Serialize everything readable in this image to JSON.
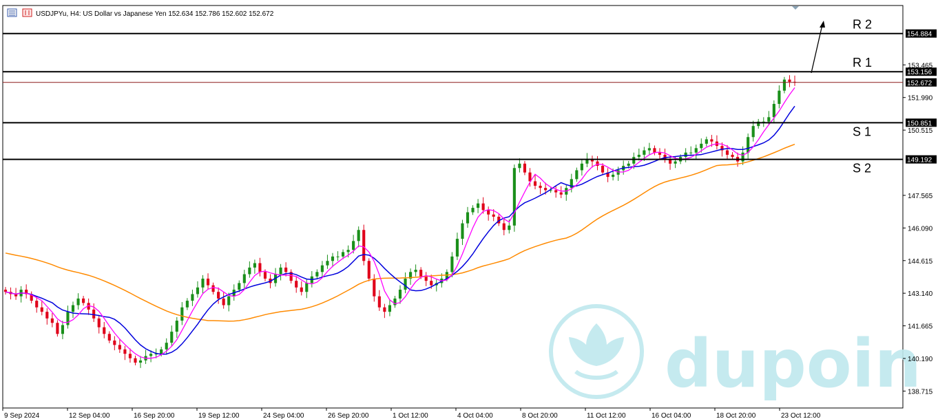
{
  "header": {
    "symbol_text": "USDJPYu, H4:  US Dollar vs Japanese Yen  152.634 152.786 152.602 152.672",
    "icon": "chart-window-icon"
  },
  "watermark": {
    "text": "dupoin",
    "icon": "lotus-logo-icon"
  },
  "colors": {
    "bull": "#1a8f1a",
    "bear": "#e0001a",
    "ma_fast": "#ff00ff",
    "ma_mid": "#0000dd",
    "ma_slow": "#ff8a00",
    "level_line": "#000000",
    "bid_line": "#8b1a1a",
    "tag_bg": "#000000",
    "watermark": "#bfe8ee"
  },
  "levels": [
    {
      "label": "R 2",
      "price": "154.884",
      "value": 154.884
    },
    {
      "label": "R 1",
      "price": "153.156",
      "value": 153.156
    },
    {
      "label": "S 1",
      "price": "150.851",
      "value": 150.851
    },
    {
      "label": "S 2",
      "price": "149.192",
      "value": 149.192
    }
  ],
  "current_price": {
    "price": "152.672",
    "value": 152.672
  },
  "chart_data": {
    "type": "candlestick",
    "title": "USDJPYu, H4:  US Dollar vs Japanese Yen",
    "ohlc_header": {
      "open": 152.634,
      "high": 152.786,
      "low": 152.602,
      "close": 152.672
    },
    "y_ticks": [
      "153.465",
      "151.990",
      "150.515",
      "147.565",
      "146.090",
      "144.615",
      "143.140",
      "141.665",
      "140.190",
      "138.715"
    ],
    "y_tick_values": [
      153.465,
      151.99,
      150.515,
      147.565,
      146.09,
      144.615,
      143.14,
      141.665,
      140.19,
      138.715
    ],
    "ylim": [
      137.95,
      156.15
    ],
    "x_ticks": [
      "9 Sep 2024",
      "12 Sep 04:00",
      "16 Sep 20:00",
      "19 Sep 12:00",
      "24 Sep 04:00",
      "26 Sep 20:00",
      "1 Oct 12:00",
      "4 Oct 04:00",
      "8 Oct 20:00",
      "11 Oct 12:00",
      "16 Oct 04:00",
      "18 Oct 20:00",
      "23 Oct 12:00"
    ],
    "closes": [
      143.2,
      143.1,
      143.0,
      143.3,
      143.1,
      142.8,
      142.5,
      142.3,
      142.0,
      141.8,
      141.3,
      141.7,
      142.3,
      142.6,
      142.9,
      142.7,
      142.4,
      142.0,
      141.6,
      141.3,
      141.0,
      140.8,
      140.6,
      140.4,
      140.2,
      140.0,
      140.1,
      140.3,
      140.4,
      140.4,
      140.6,
      140.9,
      141.4,
      141.9,
      142.5,
      142.8,
      143.1,
      143.4,
      143.8,
      143.5,
      143.2,
      142.9,
      142.6,
      143.0,
      143.3,
      143.6,
      144.0,
      144.3,
      144.5,
      144.1,
      143.8,
      143.6,
      144.0,
      144.3,
      144.1,
      143.7,
      143.4,
      143.2,
      143.6,
      143.9,
      144.1,
      144.4,
      144.6,
      144.8,
      144.8,
      145.0,
      145.1,
      145.5,
      146.0,
      144.6,
      143.8,
      143.0,
      142.5,
      142.3,
      142.6,
      142.9,
      143.3,
      143.8,
      144.1,
      144.2,
      143.9,
      143.7,
      143.5,
      143.6,
      143.8,
      144.1,
      144.8,
      145.6,
      146.3,
      146.8,
      147.0,
      147.2,
      146.9,
      146.7,
      146.6,
      146.3,
      146.0,
      146.2,
      148.8,
      149.0,
      148.6,
      148.2,
      148.0,
      147.9,
      147.8,
      147.8,
      147.7,
      147.6,
      147.9,
      148.3,
      148.7,
      149.0,
      149.2,
      149.1,
      148.9,
      148.6,
      148.4,
      148.5,
      148.7,
      148.9,
      149.0,
      149.3,
      149.4,
      149.6,
      149.7,
      149.5,
      149.4,
      149.2,
      149.0,
      149.1,
      149.3,
      149.5,
      149.5,
      149.7,
      149.9,
      150.1,
      150.0,
      149.8,
      149.6,
      149.4,
      149.3,
      149.1,
      149.5,
      150.2,
      150.7,
      150.9,
      150.9,
      151.1,
      151.7,
      152.3,
      152.8,
      152.7,
      152.672
    ],
    "series": [
      {
        "name": "ma_fast"
      },
      {
        "name": "ma_mid"
      },
      {
        "name": "ma_slow"
      }
    ],
    "grid": false
  }
}
